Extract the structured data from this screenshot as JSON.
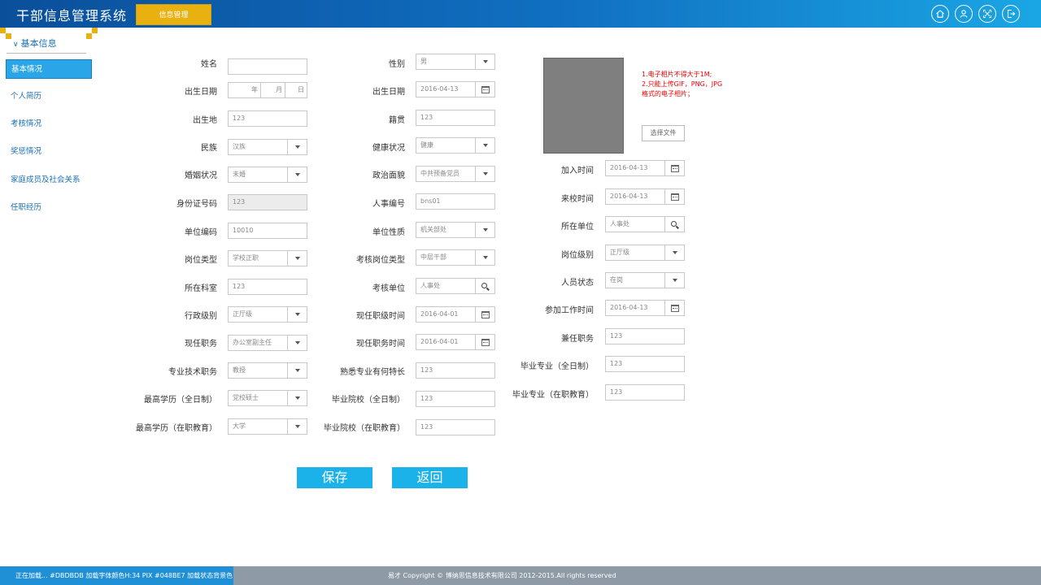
{
  "header": {
    "app_title": "干部信息管理系统",
    "module_tab": "信息管理",
    "icons": [
      "home-icon",
      "user-icon",
      "fullscreen-icon",
      "logout-icon"
    ]
  },
  "sidebar": {
    "title": "基本信息",
    "items": [
      {
        "label": "基本情况",
        "active": true
      },
      {
        "label": "个人简历"
      },
      {
        "label": "考核情况"
      },
      {
        "label": "奖惩情况"
      },
      {
        "label": "家庭成员及社会关系"
      },
      {
        "label": "任职经历"
      }
    ]
  },
  "form": {
    "col1": [
      {
        "label": "姓名",
        "value": ""
      },
      {
        "label": "出生日期",
        "date_parts": [
          "年",
          "月",
          "日"
        ]
      },
      {
        "label": "出生地",
        "value": "123"
      },
      {
        "label": "民族",
        "value": "汉族"
      },
      {
        "label": "婚姻状况",
        "value": "未婚"
      },
      {
        "label": "身份证号码",
        "value": "123"
      },
      {
        "label": "单位编码",
        "value": "10010"
      },
      {
        "label": "岗位类型",
        "value": "学校正职"
      },
      {
        "label": "所在科室",
        "value": "123"
      },
      {
        "label": "行政级别",
        "value": "正厅级"
      },
      {
        "label": "现任职务",
        "value": "办公室副主任"
      },
      {
        "label": "专业技术职务",
        "value": "教授"
      },
      {
        "label": "最高学历（全日制）",
        "value": "党校硕士"
      },
      {
        "label": "最高学历（在职教育）",
        "value": "大学"
      }
    ],
    "col2": [
      {
        "label": "性别",
        "value": "男"
      },
      {
        "label": "出生日期",
        "value": "2016-04-13"
      },
      {
        "label": "籍贯",
        "value": "123"
      },
      {
        "label": "健康状况",
        "value": "健康"
      },
      {
        "label": "政治面貌",
        "value": "中共预备党员"
      },
      {
        "label": "人事编号",
        "value": "bns01"
      },
      {
        "label": "单位性质",
        "value": "机关部处"
      },
      {
        "label": "考核岗位类型",
        "value": "中层干部"
      },
      {
        "label": "考核单位",
        "value": "人事处"
      },
      {
        "label": "现任职级时间",
        "value": "2016-04-01"
      },
      {
        "label": "现任职务时间",
        "value": "2016-04-01"
      },
      {
        "label": "熟悉专业有何特长",
        "value": "123"
      },
      {
        "label": "毕业院校（全日制）",
        "value": "123"
      },
      {
        "label": "毕业院校（在职教育）",
        "value": "123"
      }
    ],
    "col3": [
      {
        "label": "加入时间",
        "value": "2016-04-13"
      },
      {
        "label": "来校时间",
        "value": "2016-04-13"
      },
      {
        "label": "所在单位",
        "value": "人事处"
      },
      {
        "label": "岗位级别",
        "value": "正厅级"
      },
      {
        "label": "人员状态",
        "value": "在岗"
      },
      {
        "label": "参加工作时间",
        "value": "2016-04-13"
      },
      {
        "label": "兼任职务",
        "value": "123"
      },
      {
        "label": "毕业专业（全日制）",
        "value": "123"
      },
      {
        "label": "毕业专业（在职教育）",
        "value": "123"
      }
    ]
  },
  "photo": {
    "notes": "1.电子相片不得大于1M;\n2.只能上传GIF，PNG，JPG\n格式的电子相片；",
    "choose_file_label": "选择文件"
  },
  "actions": {
    "save": "保存",
    "back": "返回"
  },
  "footer": {
    "status": "正在加载...  #DBDBDB  加载字体颜色H:34 PIX #048BE7  加载状态背景色",
    "copyright": "易才 Copyright © 博纳思信息技术有限公司 2012-2015.All rights reserved"
  },
  "colors": {
    "header_start": "#0a4f9a",
    "header_end": "#1aa6e4",
    "accent_tab": "#e9b10f",
    "sidebar_active": "#2aa6e8",
    "button": "#1bb2e9",
    "footer": "#8e9aa6",
    "footer_status": "#1f8fd6",
    "warning_text": "#ee0000"
  }
}
